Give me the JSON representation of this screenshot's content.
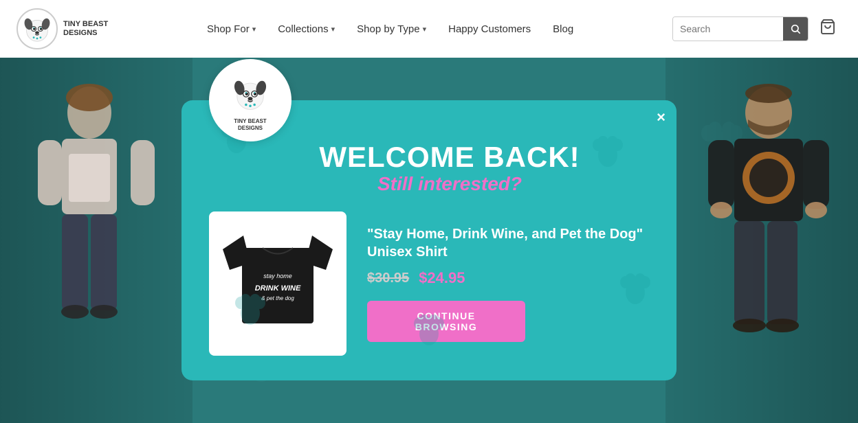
{
  "header": {
    "logo_brand": "Tiny Beast Designs",
    "nav_items": [
      {
        "label": "Shop For",
        "has_dropdown": true
      },
      {
        "label": "Collections",
        "has_dropdown": true
      },
      {
        "label": "Shop by Type",
        "has_dropdown": true
      },
      {
        "label": "Happy Customers",
        "has_dropdown": false
      },
      {
        "label": "Blog",
        "has_dropdown": false
      }
    ],
    "search_placeholder": "Search",
    "cart_icon": "🛒"
  },
  "modal": {
    "close_label": "×",
    "title": "WELCOME BACK!",
    "subtitle": "Still interested?",
    "product": {
      "name": "\"Stay Home, Drink Wine, and Pet the Dog\" Unisex Shirt",
      "price_original": "$30.95",
      "price_sale": "$24.95"
    },
    "cta_label": "CONTINUE BROWSING"
  },
  "brand": {
    "logo_text_line1": "Tiny Beast",
    "logo_text_line2": "Designs"
  }
}
